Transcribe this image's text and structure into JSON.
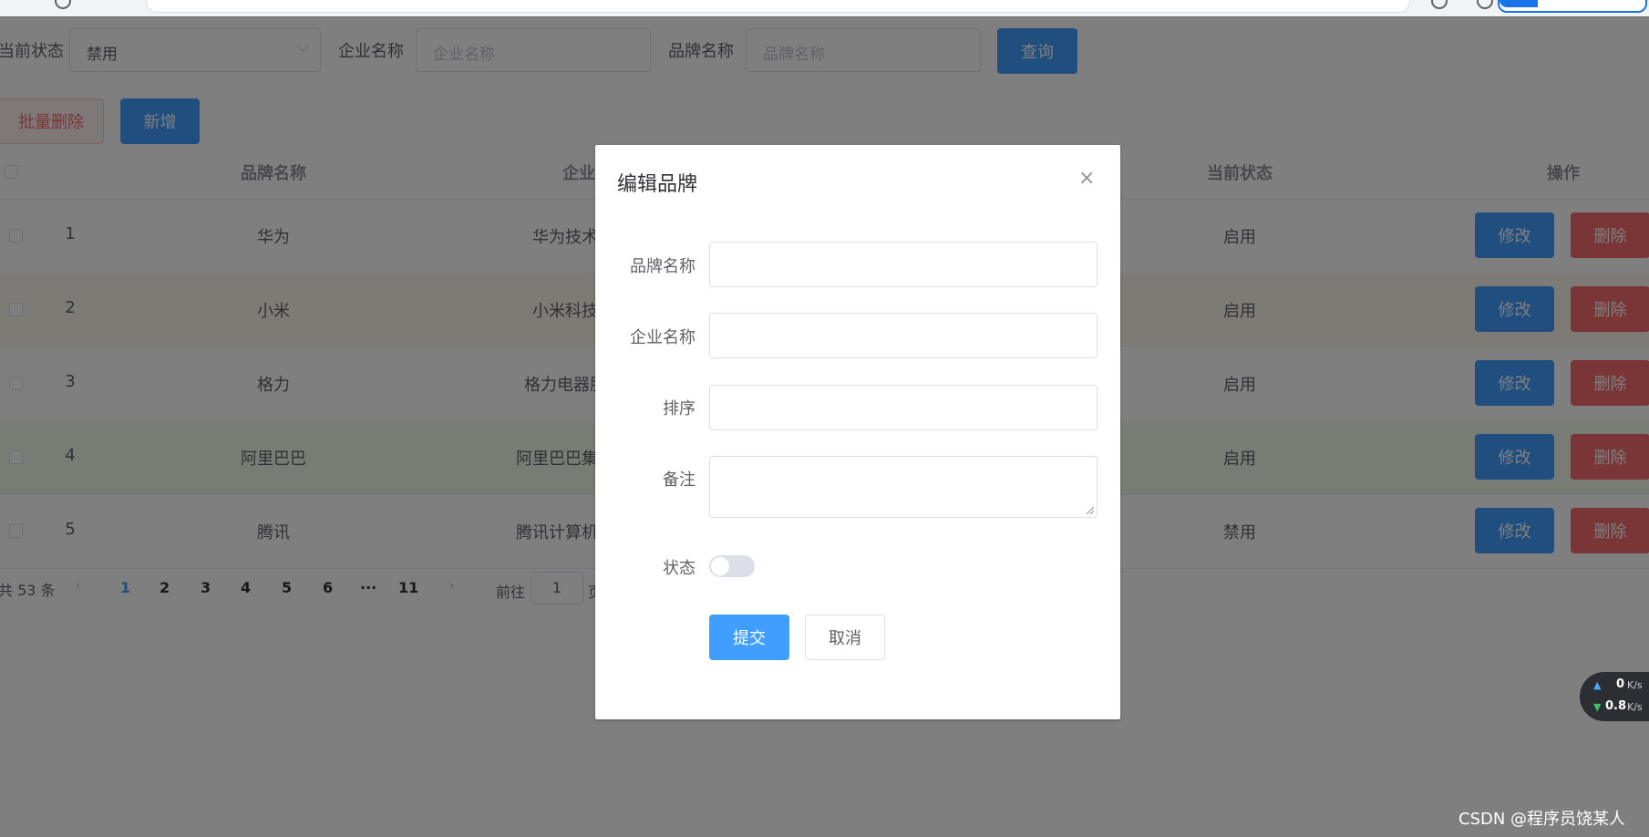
{
  "search": {
    "status_label": "当前状态",
    "status_value": "禁用",
    "company_label": "企业名称",
    "company_placeholder": "企业名称",
    "brand_label": "品牌名称",
    "brand_placeholder": "品牌名称",
    "query_button": "查询"
  },
  "toolbar": {
    "batch_delete": "批量删除",
    "add": "新增"
  },
  "table": {
    "headers": {
      "brand": "品牌名称",
      "company": "企业",
      "status": "当前状态",
      "actions": "操作"
    },
    "rows": [
      {
        "index": "1",
        "brand": "华为",
        "company": "华为技术",
        "status": "启用",
        "edit": "修改",
        "delete": "删除"
      },
      {
        "index": "2",
        "brand": "小米",
        "company": "小米科技",
        "status": "启用",
        "edit": "修改",
        "delete": "删除"
      },
      {
        "index": "3",
        "brand": "格力",
        "company": "格力电器股",
        "status": "启用",
        "edit": "修改",
        "delete": "删除"
      },
      {
        "index": "4",
        "brand": "阿里巴巴",
        "company": "阿里巴巴集团",
        "status": "启用",
        "edit": "修改",
        "delete": "删除"
      },
      {
        "index": "5",
        "brand": "腾讯",
        "company": "腾讯计算机系",
        "status": "禁用",
        "edit": "修改",
        "delete": "删除"
      }
    ]
  },
  "pagination": {
    "total": "共 53 条",
    "pages": [
      "1",
      "2",
      "3",
      "4",
      "5",
      "6",
      "···",
      "11"
    ],
    "goto_label": "前往",
    "goto_value": "1",
    "goto_suffix": "页"
  },
  "dialog": {
    "title": "编辑品牌",
    "close": "×",
    "fields": {
      "brand": "品牌名称",
      "company": "企业名称",
      "order": "排序",
      "remark": "备注",
      "status": "状态"
    },
    "submit": "提交",
    "cancel": "取消"
  },
  "net": {
    "up": "0",
    "down": "0.8",
    "unit": "K/s"
  },
  "watermark": "CSDN @程序员饶某人",
  "colors": {
    "primary": "#409eff",
    "danger": "#f56c6c"
  }
}
